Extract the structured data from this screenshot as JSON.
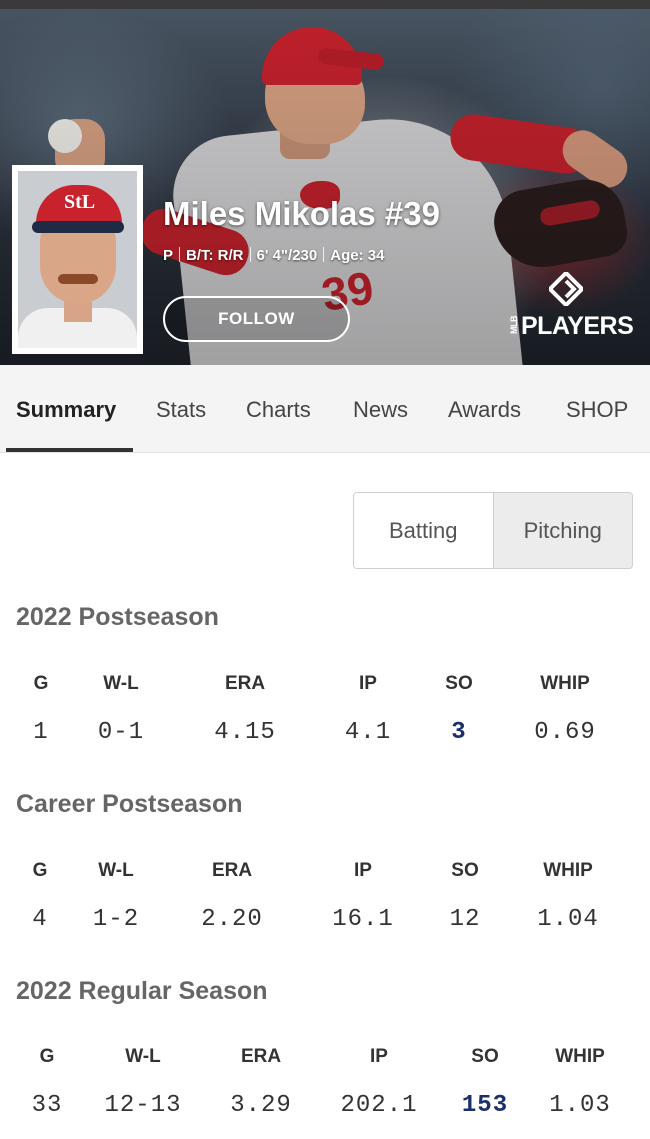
{
  "player": {
    "name": "Miles Mikolas #39",
    "position": "P",
    "bats_throws": "B/T: R/R",
    "height_weight": "6' 4\"/230",
    "age": "Age: 34",
    "follow_label": "FOLLOW"
  },
  "brand": {
    "logo_text": "PLAYERS",
    "logo_small": "MLB"
  },
  "tabs": [
    {
      "label": "Summary",
      "active": true
    },
    {
      "label": "Stats"
    },
    {
      "label": "Charts"
    },
    {
      "label": "News"
    },
    {
      "label": "Awards"
    },
    {
      "label": "SHOP"
    }
  ],
  "toggle": {
    "batting_label": "Batting",
    "pitching_label": "Pitching",
    "selected": "Pitching"
  },
  "sections": [
    {
      "title": "2022 Postseason",
      "headers": [
        "G",
        "W-L",
        "ERA",
        "IP",
        "SO",
        "WHIP"
      ],
      "values": [
        "1",
        "0-1",
        "4.15",
        "4.1",
        "3",
        "0.69"
      ]
    },
    {
      "title": "Career Postseason",
      "headers": [
        "G",
        "W-L",
        "ERA",
        "IP",
        "SO",
        "WHIP"
      ],
      "values": [
        "4",
        "1-2",
        "2.20",
        "16.1",
        "12",
        "1.04"
      ]
    },
    {
      "title": "2022 Regular Season",
      "headers": [
        "G",
        "W-L",
        "ERA",
        "IP",
        "SO",
        "WHIP"
      ],
      "values": [
        "33",
        "12-13",
        "3.29",
        "202.1",
        "153",
        "1.03"
      ]
    }
  ],
  "colors": {
    "cardinals_red": "#c8222d",
    "link_blue": "#1a2f6b",
    "section_gray": "#666666"
  }
}
